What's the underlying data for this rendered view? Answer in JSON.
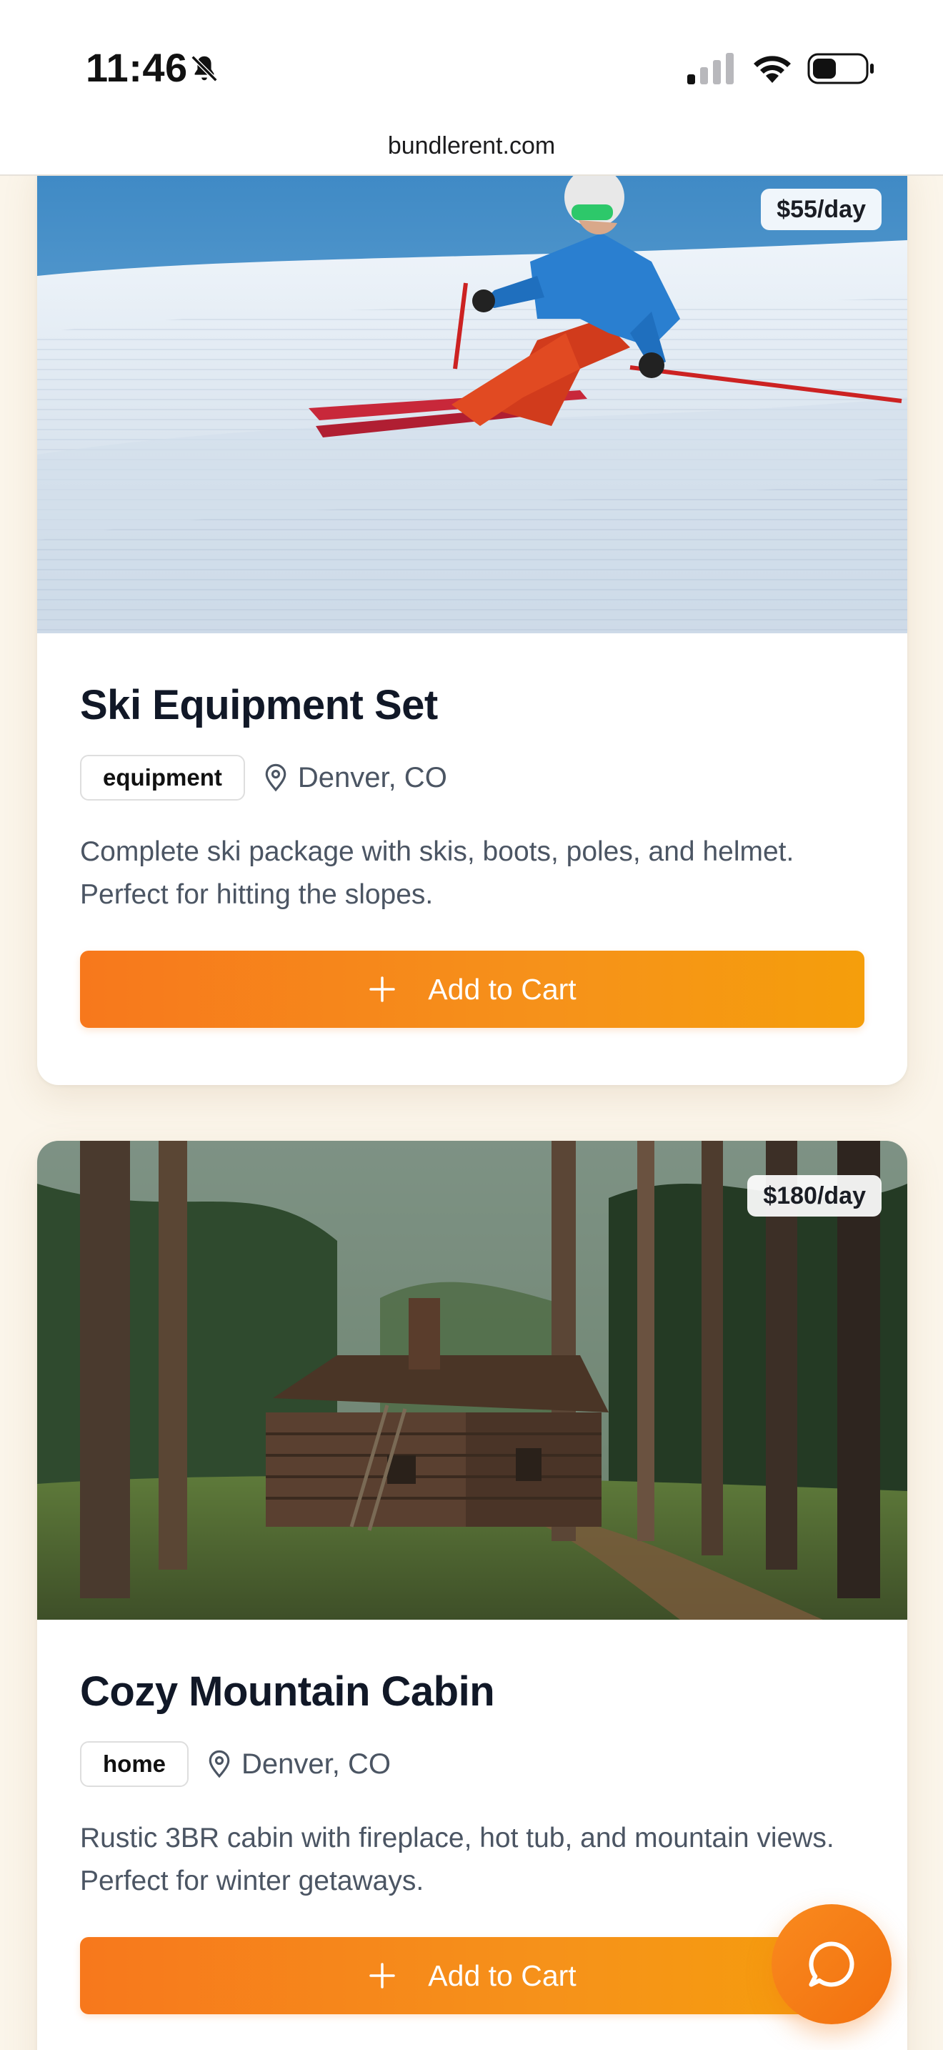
{
  "status_bar": {
    "time": "11:46",
    "icons": [
      "bell-off-icon",
      "cellular-signal-icon",
      "wifi-icon",
      "battery-icon"
    ]
  },
  "browser": {
    "url": "bundlerent.com"
  },
  "listings": [
    {
      "title": "Ski Equipment Set",
      "price": "$55/day",
      "category": "equipment",
      "location": "Denver, CO",
      "description": "Complete ski package with skis, boots, poles, and helmet. Perfect for hitting the slopes.",
      "button_label": "Add to Cart",
      "image_subject": "skier carving on groomed snow slope"
    },
    {
      "title": "Cozy Mountain Cabin",
      "price": "$180/day",
      "category": "home",
      "location": "Denver, CO",
      "description": "Rustic 3BR cabin with fireplace, hot tub, and mountain views. Perfect for winter getaways.",
      "button_label": "Add to Cart",
      "image_subject": "log cabin in pine forest"
    }
  ],
  "chat": {
    "icon": "chat-bubble-icon"
  },
  "colors": {
    "accent_start": "#F7781C",
    "accent_end": "#F59E0B",
    "page_background": "#FBF5EA",
    "title_text": "#111827",
    "body_text": "#4b5563"
  }
}
